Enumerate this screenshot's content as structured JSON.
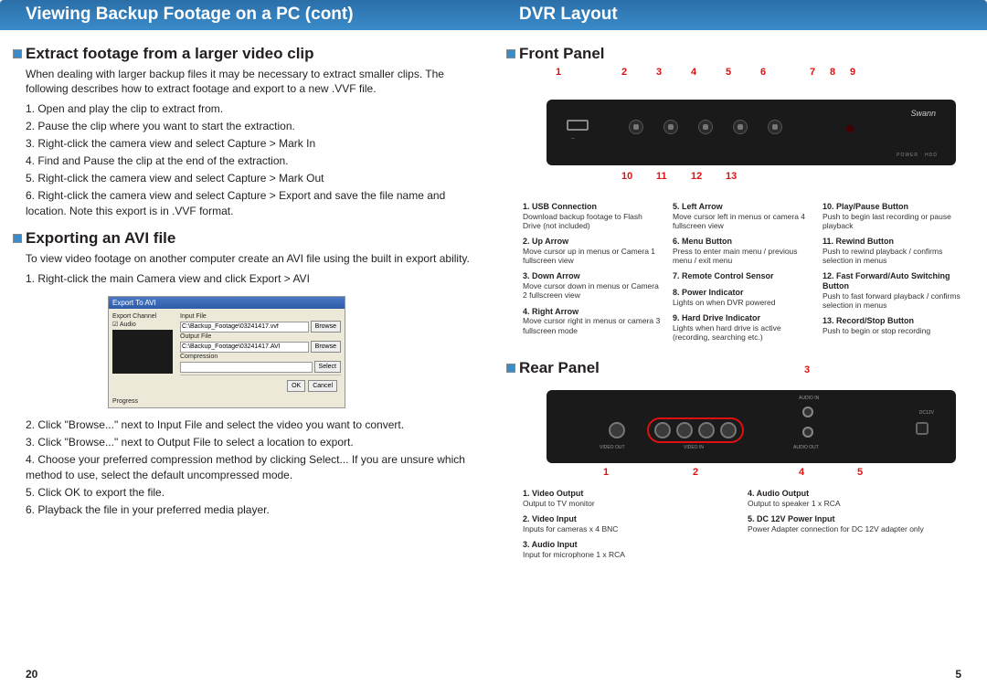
{
  "left": {
    "header": "Viewing Backup Footage on a PC (cont)",
    "section1": {
      "title": "Extract footage from a larger video clip",
      "intro": "When dealing with larger backup files it may be necessary to extract smaller clips. The following describes how to extract footage and export to a new .VVF file.",
      "steps": [
        "1.  Open and play the clip to extract from.",
        "2.  Pause the clip where you want to start the extraction.",
        "3.  Right-click the camera view and select Capture > Mark In",
        "4.  Find and Pause the clip at the end of the extraction.",
        "5.  Right-click the camera view and select Capture > Mark Out",
        "6.  Right-click the camera view and select Capture > Export and save the file name and location.  Note this export is in .VVF format."
      ]
    },
    "section2": {
      "title": "Exporting an AVI file",
      "intro": "To view video footage on another computer create an AVI file using the built in export ability.",
      "step1": "1.  Right-click the main Camera view and click Export > AVI",
      "dialog": {
        "title": "Export To AVI",
        "export_channel": "Export Channel",
        "audio_chk": "Audio",
        "input_file_lbl": "Input File",
        "input_file_val": "C:\\Backup_Footage\\03241417.vvf",
        "output_file_lbl": "Output File",
        "output_file_val": "C:\\Backup_Footage\\03241417.AVI",
        "compression_lbl": "Compression",
        "browse": "Browse",
        "select": "Select",
        "progress": "Progress",
        "ok": "OK",
        "cancel": "Cancel"
      },
      "steps_after": [
        "2.  Click \"Browse...\" next to Input File and select the video you want to convert.",
        "3.  Click \"Browse...\" next to Output File to select a location to export.",
        "4.  Choose your preferred compression method by clicking Select...  If you are unsure which method to use, select the default uncompressed mode.",
        "5.  Click OK to export the file.",
        "6.  Playback the file in your preferred media player."
      ]
    },
    "page_num": "20"
  },
  "right": {
    "header": "DVR Layout",
    "front": {
      "title": "Front Panel",
      "callouts_top": [
        "1",
        "2",
        "3",
        "4",
        "5",
        "6",
        "7",
        "8",
        "9"
      ],
      "callouts_bottom": [
        "10",
        "11",
        "12",
        "13"
      ],
      "legend": [
        {
          "t": "1.  USB Connection",
          "d": "Download backup footage to Flash Drive (not included)"
        },
        {
          "t": "2.  Up Arrow",
          "d": "Move cursor up in menus or Camera 1 fullscreen view"
        },
        {
          "t": "3.  Down Arrow",
          "d": "Move cursor down in menus or Camera 2 fullscreen view"
        },
        {
          "t": "4.  Right Arrow",
          "d": "Move cursor right in menus or camera 3 fullscreen mode"
        },
        {
          "t": "5.  Left Arrow",
          "d": "Move cursor left in menus or camera 4 fullscreen view"
        },
        {
          "t": "6.  Menu Button",
          "d": "Press to enter main menu / previous menu / exit menu"
        },
        {
          "t": "7.  Remote Control Sensor",
          "d": ""
        },
        {
          "t": "8.  Power Indicator",
          "d": "Lights on when DVR powered"
        },
        {
          "t": "9.  Hard Drive Indicator",
          "d": "Lights when hard drive is active (recording, searching etc.)"
        },
        {
          "t": "10.  Play/Pause Button",
          "d": "Push to begin last recording or pause playback"
        },
        {
          "t": "11.  Rewind Button",
          "d": "Push to rewind playback / confirms selection in menus"
        },
        {
          "t": "12.  Fast Forward/Auto Switching Button",
          "d": "Push to fast forward playback / confirms selection in menus"
        },
        {
          "t": "13.  Record/Stop Button",
          "d": "Push to begin or stop recording"
        }
      ]
    },
    "rear": {
      "title": "Rear Panel",
      "callouts": [
        "1",
        "2",
        "3",
        "4",
        "5"
      ],
      "legend": [
        {
          "t": "1.  Video Output",
          "d": "Output to TV monitor"
        },
        {
          "t": "2.  Video Input",
          "d": "Inputs for cameras x 4 BNC"
        },
        {
          "t": "3.  Audio Input",
          "d": "Input for microphone 1 x RCA"
        },
        {
          "t": "4.  Audio Output",
          "d": "Output to speaker 1 x RCA"
        },
        {
          "t": "5.  DC 12V Power Input",
          "d": "Power Adapter connection for DC 12V adapter only"
        }
      ]
    },
    "page_num": "5"
  }
}
